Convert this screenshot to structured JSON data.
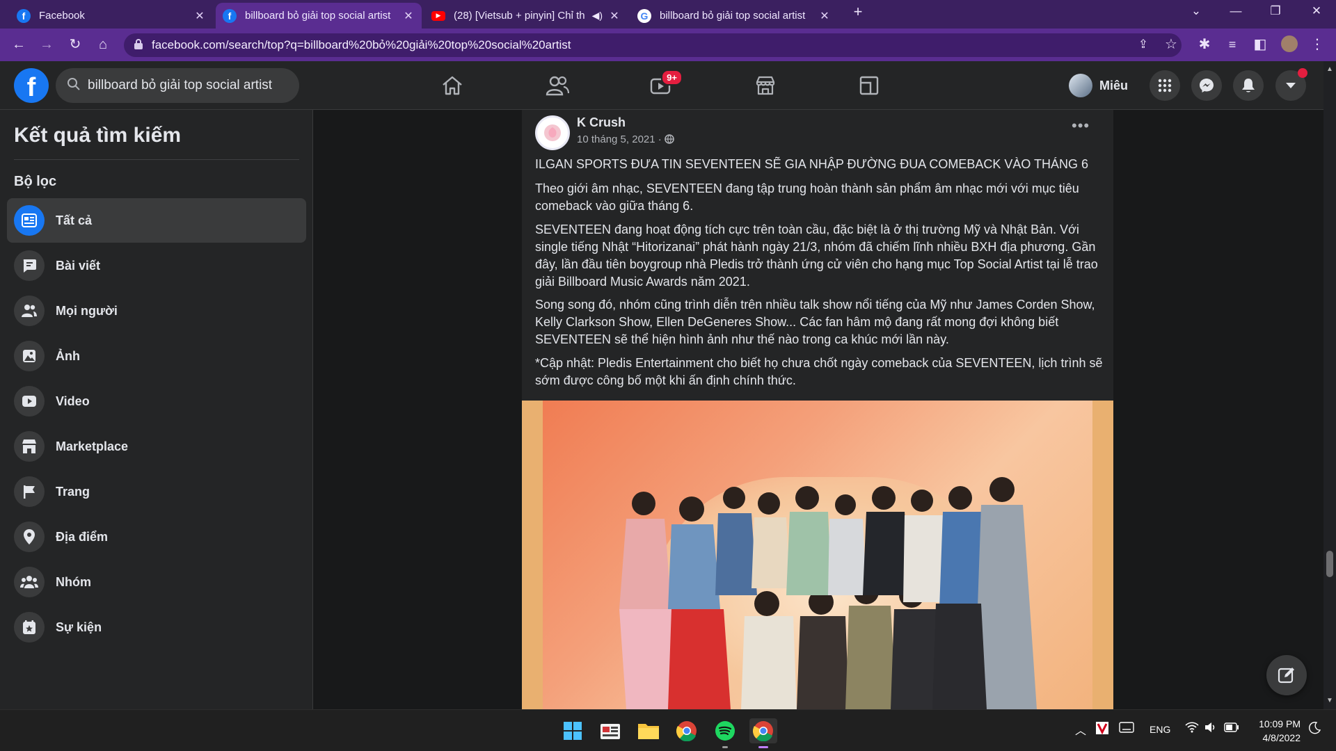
{
  "browser": {
    "tabs": [
      {
        "title": "Facebook",
        "favicon": "facebook-icon",
        "active": false
      },
      {
        "title": "billboard bỏ giải top social artist",
        "favicon": "facebook-icon",
        "active": true
      },
      {
        "title": "(28) [Vietsub + pinyin] Chỉ th",
        "favicon": "youtube-icon",
        "active": false,
        "muted_icon": "speaker-icon"
      },
      {
        "title": "billboard bỏ giải top social artist",
        "favicon": "google-icon",
        "active": false
      }
    ],
    "url": "facebook.com/search/top?q=billboard%20bỏ%20giải%20top%20social%20artist",
    "accent_color": "#5a2d91"
  },
  "fb_header": {
    "search_value": "billboard bỏ giải top social artist",
    "watch_badge": "9+",
    "profile_name": "Miêu"
  },
  "sidebar": {
    "title": "Kết quả tìm kiếm",
    "filter_heading": "Bộ lọc",
    "items": [
      {
        "label": "Tất cả",
        "icon": "all-results-icon",
        "active": true
      },
      {
        "label": "Bài viết",
        "icon": "posts-icon"
      },
      {
        "label": "Mọi người",
        "icon": "people-icon"
      },
      {
        "label": "Ảnh",
        "icon": "photos-icon"
      },
      {
        "label": "Video",
        "icon": "video-icon"
      },
      {
        "label": "Marketplace",
        "icon": "marketplace-icon"
      },
      {
        "label": "Trang",
        "icon": "pages-flag-icon"
      },
      {
        "label": "Địa điểm",
        "icon": "location-pin-icon"
      },
      {
        "label": "Nhóm",
        "icon": "groups-icon"
      },
      {
        "label": "Sự kiện",
        "icon": "events-icon"
      }
    ]
  },
  "post": {
    "author": "K Crush",
    "date": "10 tháng 5, 2021 · ",
    "paragraphs": [
      "ILGAN SPORTS ĐƯA TIN SEVENTEEN SẼ GIA NHẬP ĐƯỜNG ĐUA COMEBACK VÀO THÁNG 6",
      "Theo giới âm nhạc, SEVENTEEN đang tập trung hoàn thành sản phẩm âm nhạc mới với mục tiêu comeback vào giữa tháng 6.",
      "SEVENTEEN đang hoạt động tích cực trên toàn cầu, đặc biệt là ở thị trường Mỹ và Nhật Bản. Với single tiếng Nhật “Hitorizanai” phát hành ngày 21/3, nhóm đã chiếm lĩnh nhiều BXH địa phương. Gần đây, lần đầu tiên boygroup nhà Pledis trở thành ứng cử viên cho hạng mục Top Social Artist tại lễ trao giải Billboard Music Awards năm 2021.",
      "Song song đó, nhóm cũng trình diễn trên nhiều talk show nổi tiếng của Mỹ như James Corden Show, Kelly Clarkson Show, Ellen DeGeneres Show... Các fan hâm mộ đang rất mong đợi không biết SEVENTEEN sẽ thể hiện hình ảnh như thế nào trong ca khúc mới lần này.",
      "*Cập nhật: Pledis Entertainment cho biết họ chưa chốt ngày comeback của SEVENTEEN, lịch trình sẽ sớm được công bố một khi ấn định chính thức."
    ]
  },
  "taskbar": {
    "language": "ENG",
    "time": "10:09 PM",
    "date": "4/8/2022"
  }
}
